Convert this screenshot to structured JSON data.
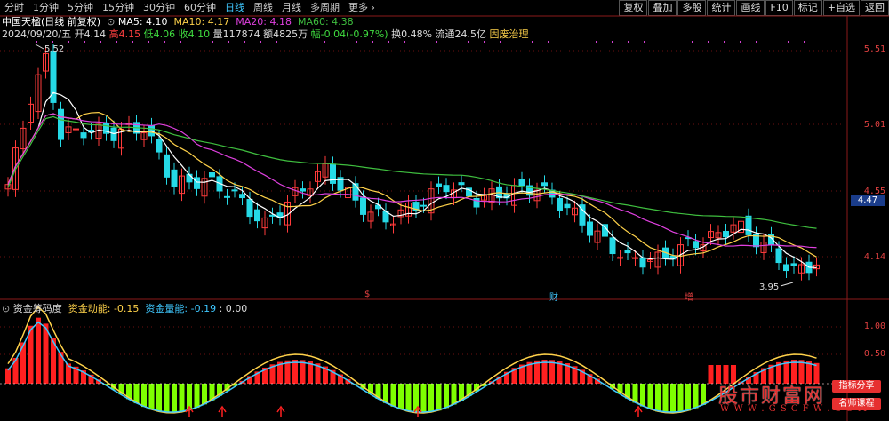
{
  "toolbar": {
    "periods": [
      "分时",
      "1分钟",
      "5分钟",
      "15分钟",
      "30分钟",
      "60分钟",
      "日线",
      "周线",
      "月线",
      "多周期",
      "更多 ›"
    ],
    "active_period": "日线",
    "right_buttons": [
      "复权",
      "叠加",
      "多股",
      "统计",
      "画线",
      "F10",
      "标记",
      "+自选",
      "返回"
    ]
  },
  "stock": {
    "name": "中国天楹(日线 前复权)",
    "ma5_label": "MA5: 4.10",
    "ma10_label": "MA10: 4.17",
    "ma20_label": "MA20: 4.18",
    "ma60_label": "MA60: 4.38",
    "date": "2024/09/20/五",
    "open_label": "开4.14",
    "high_label": "高4.15",
    "low_label": "低4.06",
    "close_label": "收4.10",
    "volume_label": "量117874",
    "amount_label": "额4825万",
    "change_label": "幅-0.04(-0.97%)",
    "turnover_label": "换0.48%",
    "float_label": "流通24.5亿",
    "tag": "固废治理"
  },
  "price_axis": [
    "5.51",
    "5.01",
    "4.55",
    "4.14"
  ],
  "current_price": "4.47",
  "annotations": {
    "high": "5.52",
    "low": "3.95"
  },
  "events": [
    {
      "label": "$",
      "color": "#e04040"
    },
    {
      "label": "财",
      "color": "#3fc8ff"
    },
    {
      "label": "增",
      "color": "#e04040"
    }
  ],
  "indicator": {
    "name": "资金筹码度",
    "line1_label": "资金动能:",
    "line1_value": "-0.15",
    "line2_label": "资金量能:",
    "line2_value": "-0.19",
    "extra_value": ": 0.00",
    "axis": [
      "1.00",
      "0.50"
    ]
  },
  "watermark": {
    "main": "股市财富网",
    "url": "W W W . G S C F W . C O M",
    "tag1": "指标分享",
    "tag2": "名师课程"
  },
  "colors": {
    "up": "#ff3b3b",
    "down": "#25d9e6",
    "ma5": "#ffffff",
    "ma10": "#ffd24a",
    "ma20": "#e040e0",
    "ma60": "#3fbf3f",
    "energy_pos": "#ff2020",
    "energy_neg": "#7fff00"
  }
}
